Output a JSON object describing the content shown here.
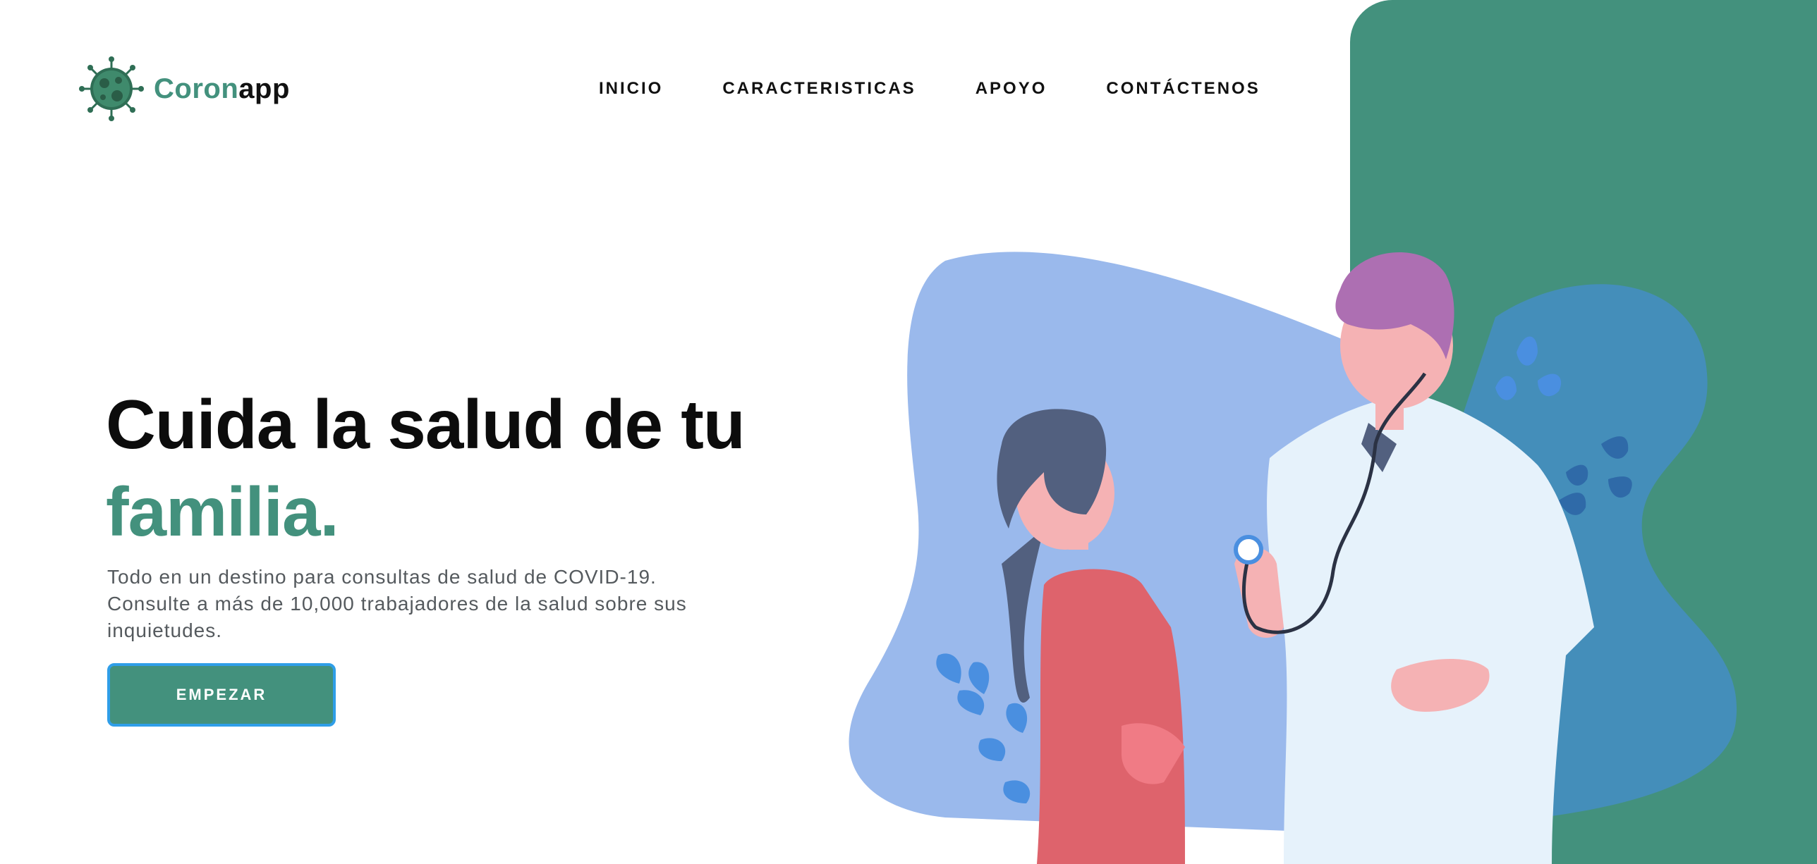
{
  "brand": {
    "name_accent": "Coron",
    "name_rest": "app",
    "icon": "virus-icon"
  },
  "nav": {
    "items": [
      {
        "label": "INICIO"
      },
      {
        "label": "CARACTERISTICAS"
      },
      {
        "label": "APOYO"
      },
      {
        "label": "CONTÁCTENOS"
      }
    ]
  },
  "hero": {
    "title_line1": "Cuida la salud de tu",
    "title_line2": "familia.",
    "description": "Todo en un destino para consultas de salud de COVID-19. Consulte a más de 10,000 trabajadores de la salud sobre sus inquietudes.",
    "cta_label": "EMPEZAR"
  },
  "illustration": {
    "icon": "doctor-patient-illustration"
  },
  "colors": {
    "accent": "#43917d",
    "cta_border": "#2f9ee8",
    "blob_light": "#9ab9ec",
    "blob_dark": "#448eba",
    "coat": "#e6f2fb",
    "hair_doctor": "#ad6fb2",
    "shirt_patient": "#de636c"
  }
}
